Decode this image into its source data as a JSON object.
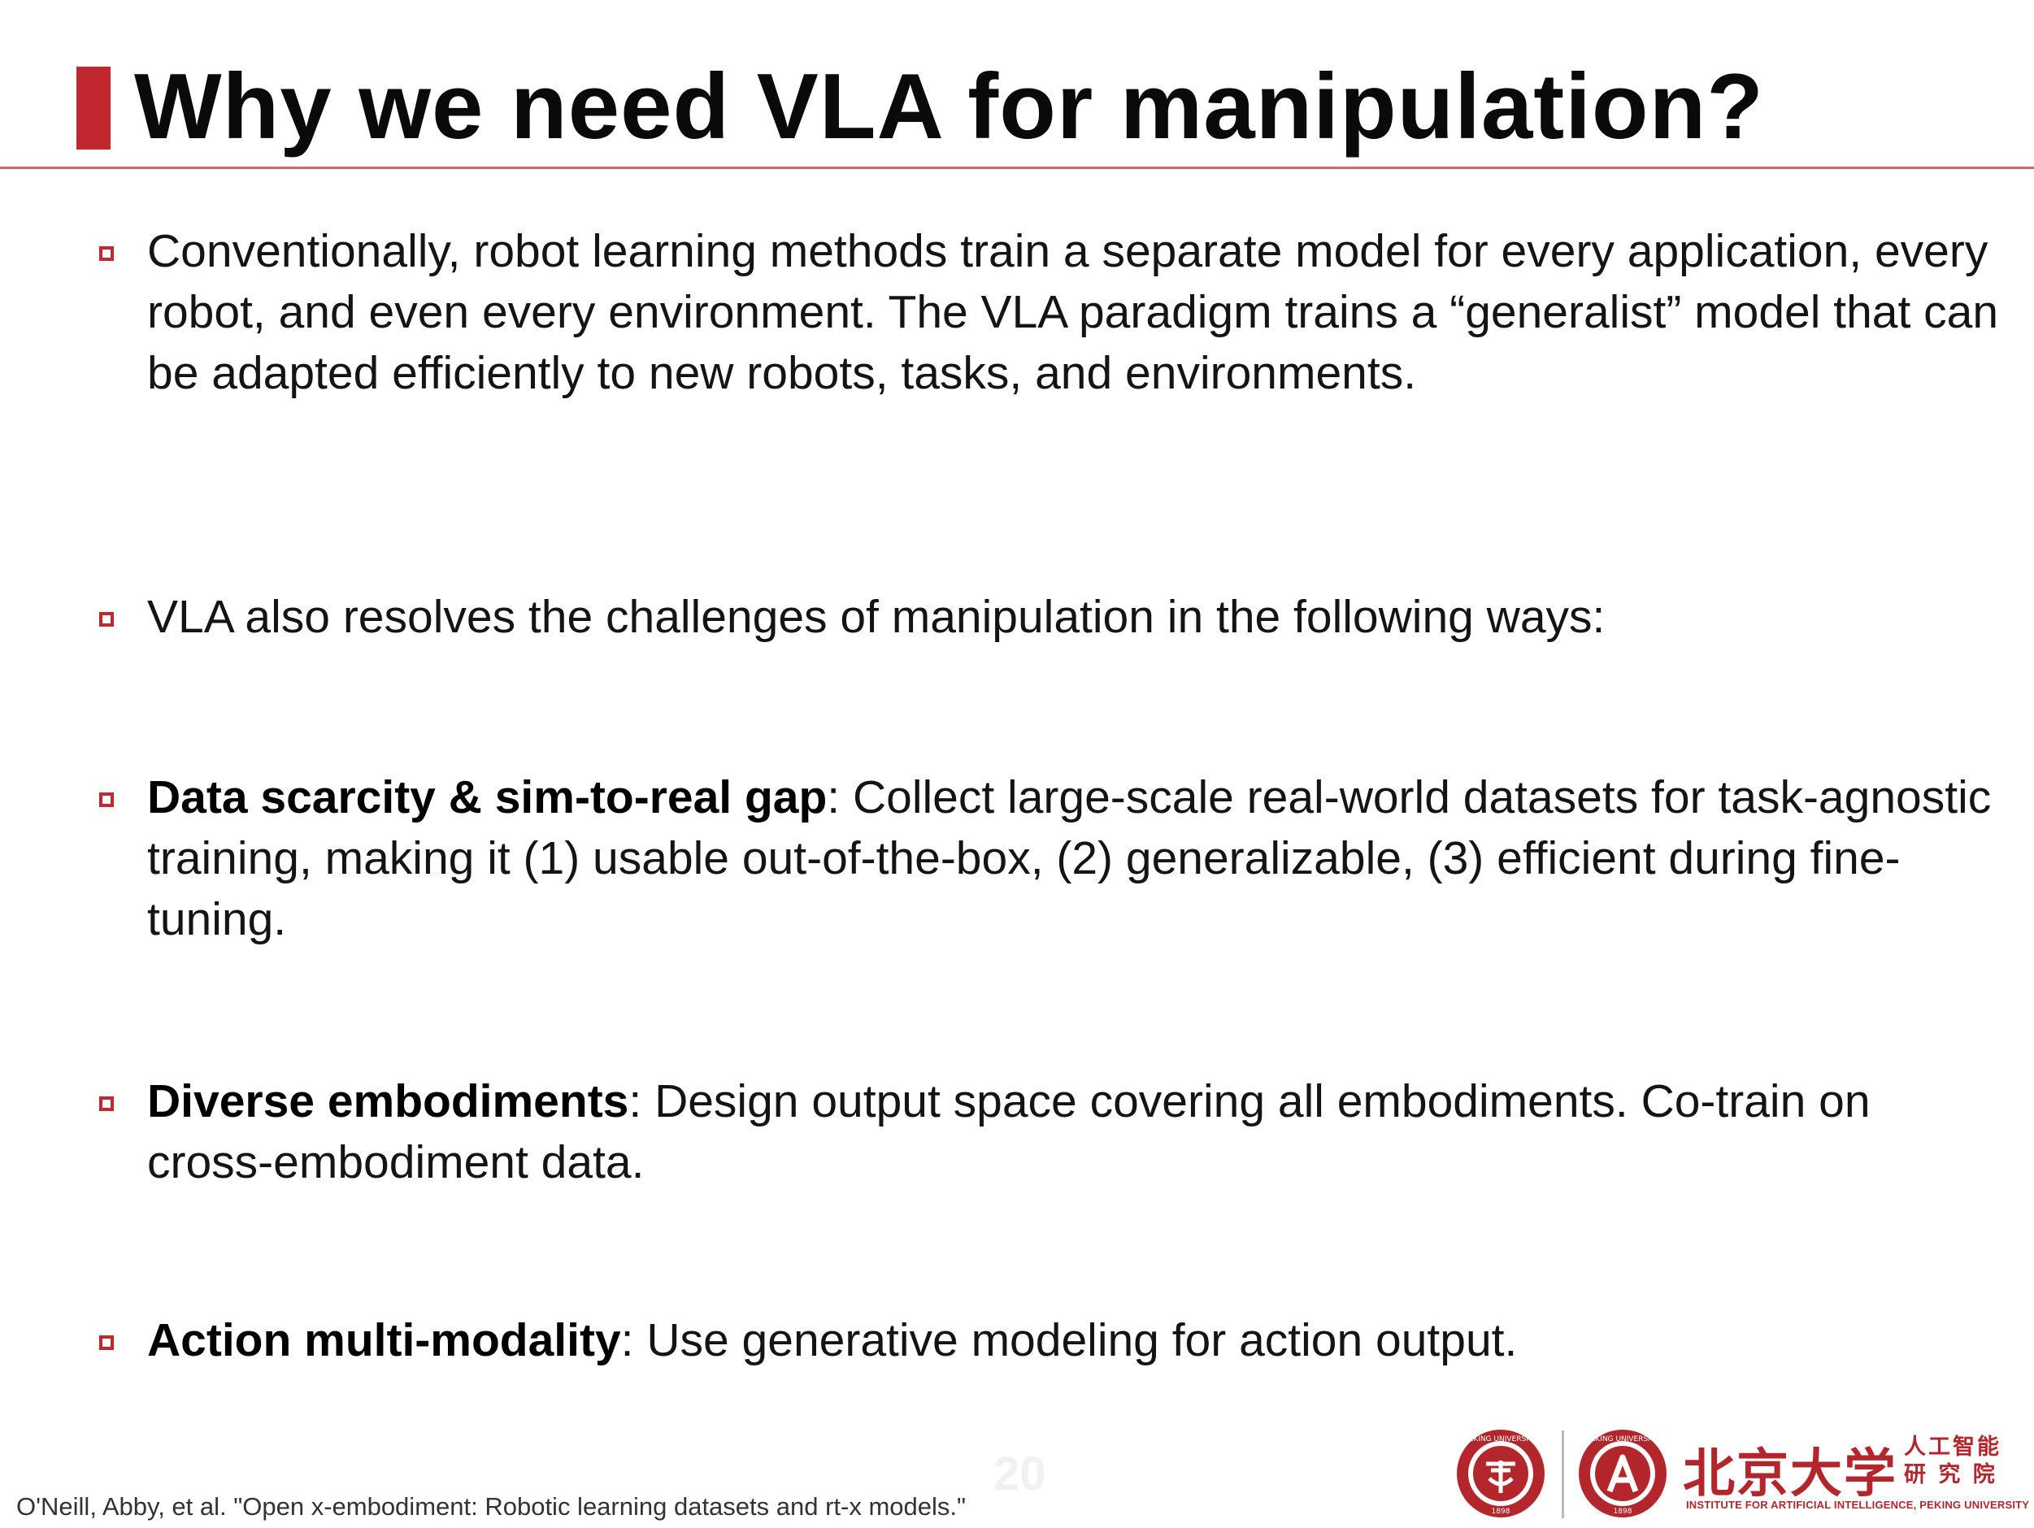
{
  "slide": {
    "title": "Why we need VLA for manipulation?",
    "page_number": "20"
  },
  "bullets": [
    {
      "bold": "",
      "text": "Conventionally, robot learning methods train a separate model for every application, every robot, and even every environment. The VLA paradigm trains a “generalist” model that can be adapted efficiently to new robots, tasks, and environments."
    },
    {
      "bold": "",
      "text": "VLA also resolves the challenges of manipulation in the following ways:"
    },
    {
      "bold": "Data scarcity & sim-to-real gap",
      "text": ": Collect large-scale real-world datasets for task-agnostic training, making it (1) usable out-of-the-box, (2) generalizable, (3) efficient during fine-tuning."
    },
    {
      "bold": "Diverse embodiments",
      "text": ": Design output space covering all embodiments. Co-train on cross-embodiment data."
    },
    {
      "bold": "Action multi-modality",
      "text": ": Use generative modeling for action output."
    }
  ],
  "footer": {
    "citation": "O'Neill, Abby, et al. \"Open x-embodiment: Robotic learning datasets and rt-x models.\"",
    "university_cn": "北京大学",
    "institute_cn_line1": "人工智能",
    "institute_cn_line2": "研 究 院",
    "institute_en": "INSTITUTE FOR ARTIFICIAL INTELLIGENCE, PEKING UNIVERSITY",
    "seal_text_1": "PEKING UNIVERSITY",
    "seal_year": "1898"
  },
  "colors": {
    "accent": "#c0282d",
    "rule": "#c96a6d"
  }
}
